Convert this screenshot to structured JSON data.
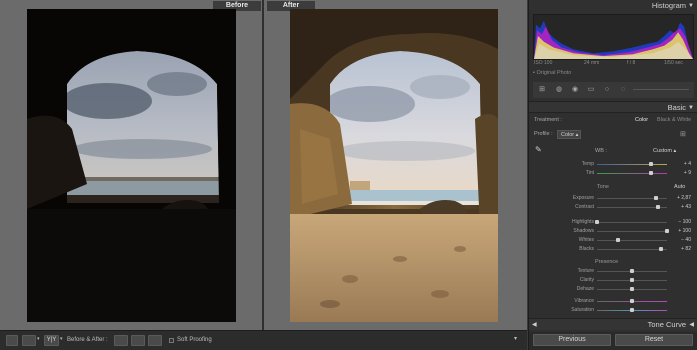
{
  "compare": {
    "before_label": "Before",
    "after_label": "After"
  },
  "toolbar": {
    "mode_label": "Before & After :",
    "soft_proofing_label": "Soft Proofing",
    "mode_icon_text": "Y|Y"
  },
  "panel": {
    "histogram_title": "Histogram",
    "histogram_readouts": [
      "ISO 100",
      "24 mm",
      "f / 8",
      "1/50 sec"
    ],
    "original_photo_label": "Original Photo",
    "basic_title": "Basic",
    "treatment_label": "Treatment :",
    "treatment_color": "Color",
    "treatment_bw": "Black & White",
    "profile_label": "Profile :",
    "profile_value": "Color",
    "wb_label": "WB :",
    "wb_value": "Custom",
    "temp": {
      "label": "Temp",
      "value": "+ 4",
      "pos": 0.77
    },
    "tint": {
      "label": "Tint",
      "value": "+ 9",
      "pos": 0.77
    },
    "tone_title": "Tone",
    "auto_label": "Auto",
    "exposure": {
      "label": "Exposure",
      "value": "+ 2,87",
      "pos": 0.84
    },
    "contrast": {
      "label": "Contrast",
      "value": "+ 43",
      "pos": 0.87
    },
    "highlights": {
      "label": "Highlights",
      "value": "− 100",
      "pos": 0.0
    },
    "shadows": {
      "label": "Shadows",
      "value": "+ 100",
      "pos": 1.0
    },
    "whites": {
      "label": "Whites",
      "value": "− 40",
      "pos": 0.3
    },
    "blacks": {
      "label": "Blacks",
      "value": "+ 82",
      "pos": 0.91
    },
    "presence_title": "Presence",
    "texture": {
      "label": "Texture",
      "value": "",
      "pos": 0.5
    },
    "clarity": {
      "label": "Clarity",
      "value": "",
      "pos": 0.5
    },
    "dehaze": {
      "label": "Dehaze",
      "value": "",
      "pos": 0.5
    },
    "vibrance": {
      "label": "Vibrance",
      "value": "",
      "pos": 0.5
    },
    "saturation": {
      "label": "Saturation",
      "value": "",
      "pos": 0.5
    },
    "tone_curve_title": "Tone Curve",
    "previous_label": "Previous",
    "reset_label": "Reset"
  }
}
